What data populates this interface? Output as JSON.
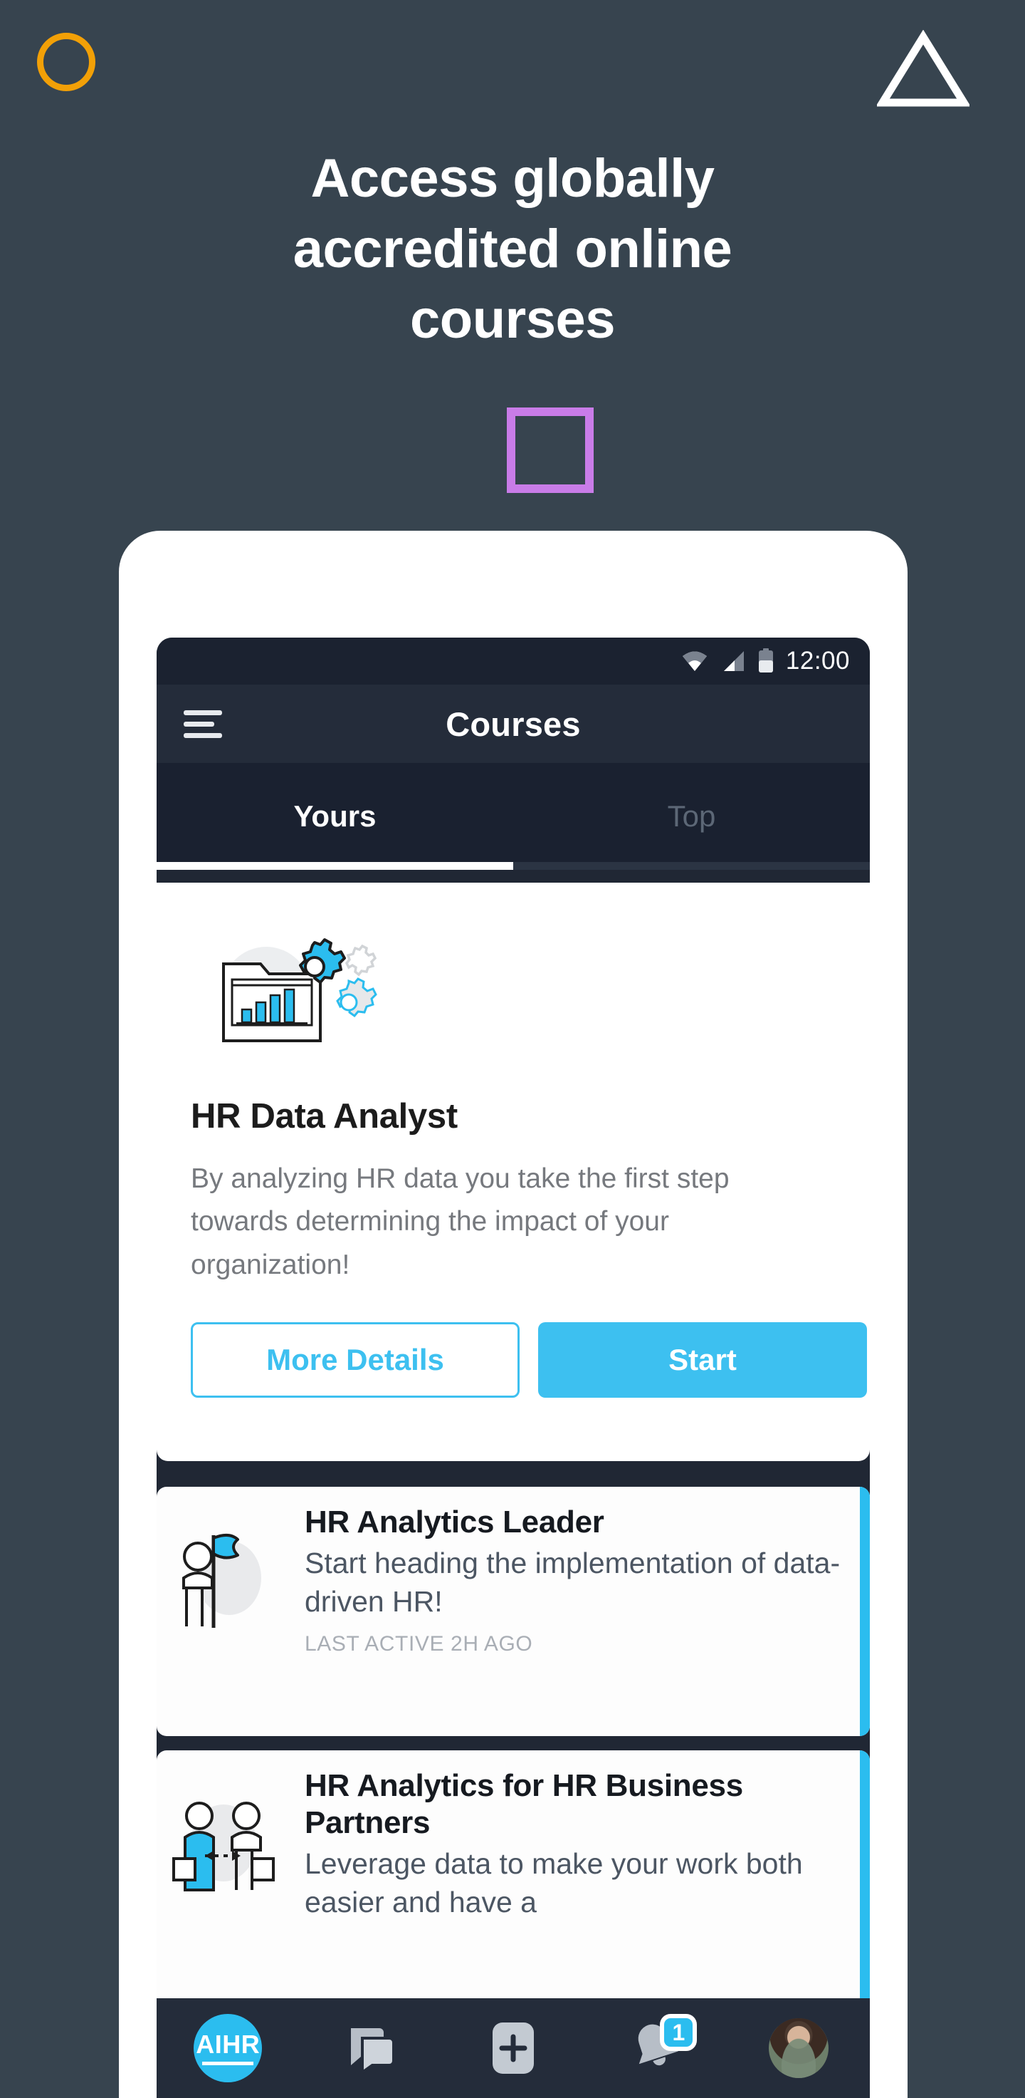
{
  "hero": {
    "headline_lines": [
      "Access globally",
      "accredited online",
      "courses"
    ],
    "colors": {
      "background": "#37444F",
      "circle": "#F2A007",
      "triangle": "#FFFFFF",
      "square": "#C97CE8",
      "accent_blue": "#3DC0F0"
    }
  },
  "phone": {
    "statusbar": {
      "time": "12:00",
      "icons": [
        "wifi-icon",
        "signal-icon",
        "battery-icon"
      ]
    },
    "appbar": {
      "menu_icon": "hamburger-menu-icon",
      "title": "Courses"
    },
    "tabs": [
      {
        "label": "Yours",
        "active": true
      },
      {
        "label": "Top",
        "active": false
      }
    ],
    "hero_card": {
      "illustration": "folder-bar-chart-gears-icon",
      "title": "HR Data Analyst",
      "description": "By analyzing HR data you take the first step towards determining the impact of your organization!",
      "buttons": {
        "secondary": "More Details",
        "primary": "Start"
      }
    },
    "course_list": [
      {
        "icon": "person-with-flag-icon",
        "title": "HR Analytics Leader",
        "description": "Start heading the implementation of data-driven HR!",
        "meta": "LAST ACTIVE 2H AGO"
      },
      {
        "icon": "two-people-exchange-icon",
        "title": "HR Analytics for HR Business Partners",
        "description": "Leverage data to make your work both easier and have a",
        "meta": ""
      }
    ],
    "bottomnav": {
      "logo_text": "AIHR",
      "items": [
        "aihr-logo",
        "chat-icon",
        "add-icon",
        "bell-icon",
        "avatar-icon"
      ],
      "notification_count": "1"
    }
  }
}
